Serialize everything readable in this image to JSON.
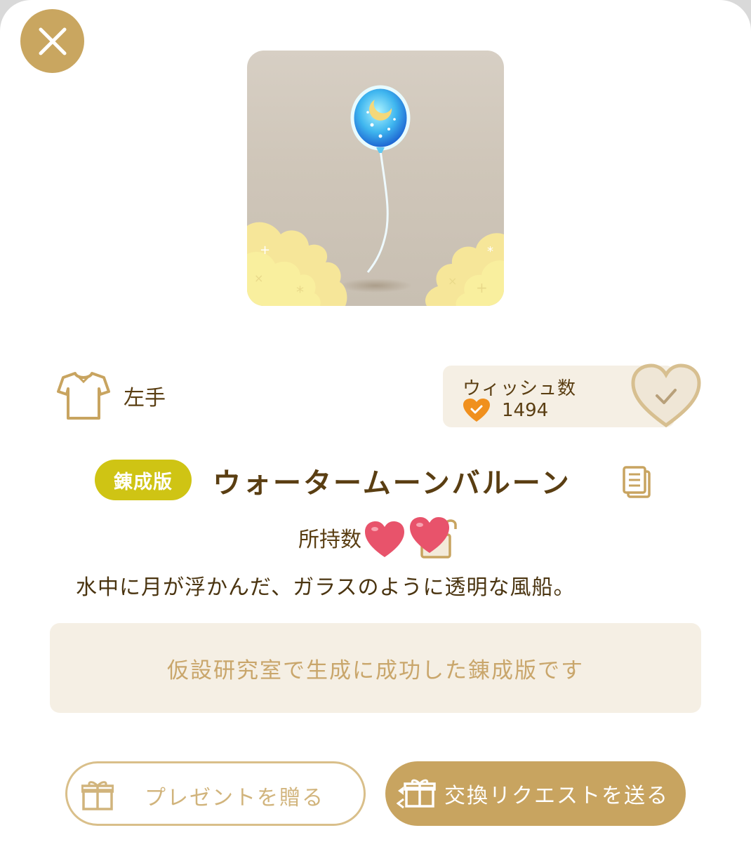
{
  "header": {
    "close_icon": "close-x-icon"
  },
  "item": {
    "image_icon": "water-moon-balloon-image",
    "category_icon": "shirt-icon",
    "category_label": "左手",
    "badge": "錬成版",
    "name": "ウォータームーンバルーン",
    "copy_icon": "copy-document-icon",
    "owned_label": "所持数",
    "owned_icons": [
      "pink-heart-icon",
      "pink-heart-icon",
      "unlocked-padlock-icon"
    ],
    "description": "水中に月が浮かんだ、ガラスのように透明な風船。"
  },
  "wish": {
    "title": "ウィッシュ数",
    "count": "1494",
    "heart_icon": "orange-heart-check-icon",
    "button_icon": "heart-check-button-icon"
  },
  "info": {
    "text": "仮設研究室で生成に成功した錬成版です"
  },
  "buttons": {
    "present_label": "プレゼントを贈る",
    "present_icon": "gift-box-icon",
    "trade_label": "交換リクエストを送る",
    "trade_icon": "exchange-gift-icon"
  },
  "colors": {
    "accent_gold": "#c8a460",
    "text_brown": "#5a3e12",
    "panel_beige": "#f5efe4",
    "badge_yellow": "#cfc414",
    "heart_pink": "#e8536b",
    "wish_orange": "#f0901e"
  }
}
